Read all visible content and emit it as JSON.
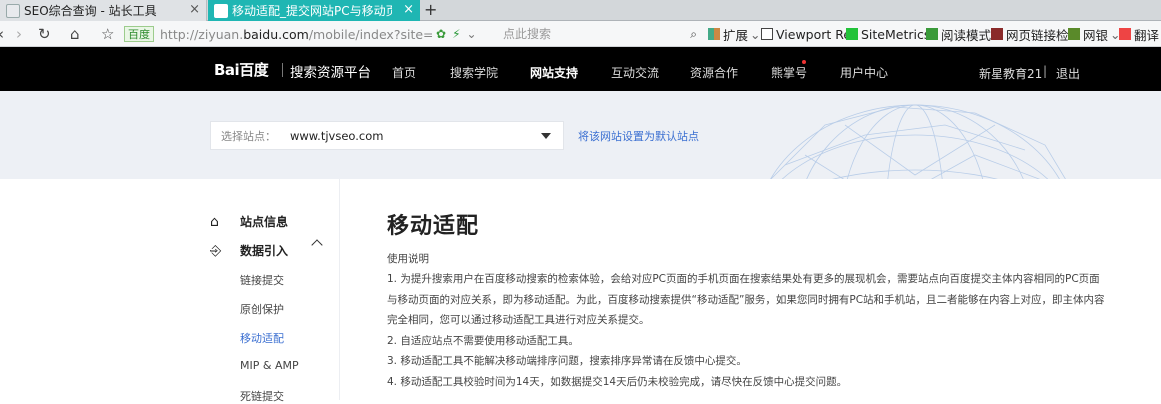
{
  "browser": {
    "tabs": [
      {
        "title": "SEO综合查询 - 站长工具",
        "active": false
      },
      {
        "title": "移动适配_提交网站PC与移动页面对",
        "active": true
      }
    ],
    "new_tab": "+",
    "address": {
      "badge": "百度",
      "url_prefix": "http://ziyuan.",
      "url_host": "baidu.com",
      "url_suffix": "/mobile/index?site=http://v"
    },
    "search_placeholder": "点此搜索",
    "bookmarks": [
      "扩展",
      "Viewport Re",
      "SiteMetrics",
      "阅读模式",
      "网页链接检",
      "网银",
      "翻译"
    ]
  },
  "header": {
    "logo": "Bai百度",
    "platform": "搜索资源平台",
    "nav": [
      "首页",
      "搜索学院",
      "网站支持",
      "互动交流",
      "资源合作",
      "熊掌号",
      "用户中心"
    ],
    "active_nav": "网站支持",
    "user": "新星教育21",
    "separator": "|",
    "logout": "退出"
  },
  "banner": {
    "select_label": "选择站点：",
    "select_value": "www.tjvseo.com",
    "set_default": "将该网站设置为默认站点"
  },
  "sidebar": {
    "sections": [
      {
        "label": "站点信息",
        "icon": "home-icon"
      },
      {
        "label": "数据引入",
        "icon": "data-import-icon"
      }
    ],
    "items": [
      "链接提交",
      "原创保护",
      "移动适配",
      "MIP & AMP",
      "死链提交"
    ],
    "active_item": "移动适配"
  },
  "main": {
    "title": "移动适配",
    "intro": "使用说明",
    "lines": [
      "1. 为提升搜索用户在百度移动搜索的检索体验，会给对应PC页面的手机页面在搜索结果处有更多的展现机会，需要站点向百度提交主体内容相同的PC页面",
      "与移动页面的对应关系，即为移动适配。为此，百度移动搜索提供“移动适配”服务，如果您同时拥有PC站和手机站，且二者能够在内容上对应，即主体内容",
      "完全相同，您可以通过移动适配工具进行对应关系提交。",
      "2. 自适应站点不需要使用移动适配工具。",
      "3. 移动适配工具不能解决移动端排序问题，搜索排序异常请在反馈中心提交。",
      "4. 移动适配工具校验时间为14天，如数据提交14天后仍未校验完成，请尽快在反馈中心提交问题。"
    ]
  },
  "colors": {
    "tab_active": "#1fb6b3",
    "header_bg": "#000000",
    "banner_bg": "#edf0f5",
    "link": "#3b6fd1"
  }
}
